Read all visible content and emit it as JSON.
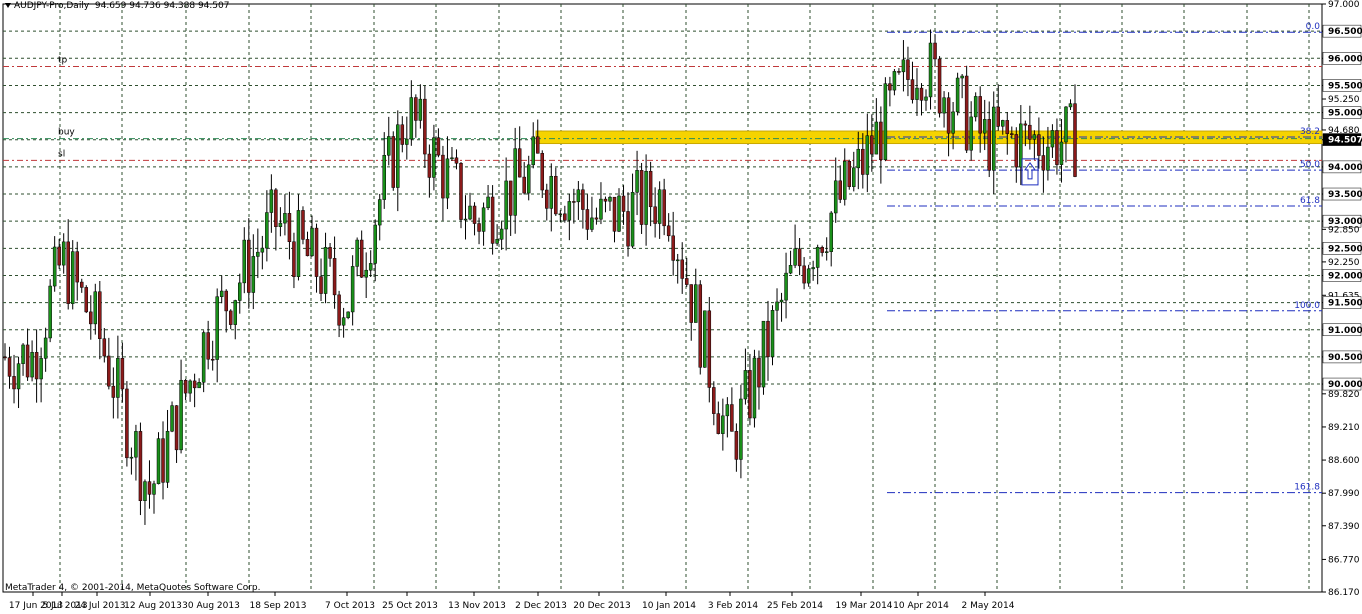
{
  "header": {
    "symbol": "AUDJPY-Pro,Daily",
    "ohlc": "94.659 94.736 94.388 94.507"
  },
  "footer": {
    "copyright": "MetaTrader 4, © 2001-2014, MetaQuotes Software Corp."
  },
  "colors": {
    "background": "#ffffff",
    "grid": "#2f4f2f",
    "bull_body": "#1a8f1a",
    "bear_body": "#8b1a1a",
    "wick": "#000000",
    "zone": "#f5d300",
    "tp_sl_line": "#c0393b",
    "buy_line": "#2e8b57",
    "fib_line": "#1f2fbf",
    "label_box": "#000000"
  },
  "chart_data": {
    "type": "candlestick",
    "title": "",
    "xlabel": "",
    "ylabel": "",
    "ylim": [
      86.17,
      97.0
    ],
    "grid": true,
    "price_axis_labels": [
      "97.000",
      "96.500",
      "96.000",
      "95.500",
      "95.250",
      "95.000",
      "94.680",
      "94.500",
      "94.000",
      "93.500",
      "93.000",
      "92.850",
      "92.500",
      "92.250",
      "92.000",
      "91.635",
      "91.500",
      "91.000",
      "90.500",
      "90.000",
      "89.820",
      "89.210",
      "88.600",
      "87.990",
      "87.390",
      "86.770",
      "86.170"
    ],
    "highlighted_price_labels": [
      "96.500",
      "96.000",
      "95.500",
      "95.000",
      "94.500",
      "94.000",
      "93.500",
      "93.000",
      "92.500",
      "92.000",
      "91.500",
      "91.000",
      "90.500",
      "90.000"
    ],
    "date_labels": [
      "17 Jun 2013",
      "5 Jul 2013",
      "24 Jul 2013",
      "12 Aug 2013",
      "30 Aug 2013",
      "18 Sep 2013",
      "7 Oct 2013",
      "25 Oct 2013",
      "13 Nov 2013",
      "2 Dec 2013",
      "20 Dec 2013",
      "10 Jan 2014",
      "3 Feb 2014",
      "25 Feb 2014",
      "19 Mar 2014",
      "10 Apr 2014",
      "2 May 2014"
    ],
    "current_price": 94.507,
    "horizontal_levels": [
      {
        "name": "tp",
        "price": 95.85
      },
      {
        "name": "buy",
        "price": 94.52
      },
      {
        "name": "sl",
        "price": 94.12
      }
    ],
    "support_zone": {
      "from_date": "13 Nov 2013",
      "price_low": 94.43,
      "price_high": 94.66
    },
    "fibonacci": {
      "from_date": "25 Feb 2014",
      "levels": [
        {
          "label": "0.0",
          "price": 96.48
        },
        {
          "label": "38.2",
          "price": 94.55
        },
        {
          "label": "50.0",
          "price": 93.94
        },
        {
          "label": "61.8",
          "price": 93.28
        },
        {
          "label": "100.0",
          "price": 91.35
        },
        {
          "label": "161.8",
          "price": 88.0
        }
      ]
    },
    "arrow_marker": {
      "date": "2 May 2014",
      "price": 94.0,
      "direction": "up"
    },
    "candles_summary": {
      "start": "17 Jun 2013",
      "end": "2 May 2014",
      "anchor_closes": [
        [
          "17 Jun 2013",
          90.5
        ],
        [
          "5 Jul 2013",
          92.3
        ],
        [
          "24 Jul 2013",
          91.0
        ],
        [
          "12 Aug 2013",
          88.0
        ],
        [
          "30 Aug 2013",
          91.0
        ],
        [
          "18 Sep 2013",
          93.0
        ],
        [
          "7 Oct 2013",
          91.5
        ],
        [
          "25 Oct 2013",
          95.0
        ],
        [
          "13 Nov 2013",
          93.0
        ],
        [
          "2 Dec 2013",
          94.0
        ],
        [
          "20 Dec 2013",
          93.0
        ],
        [
          "10 Jan 2014",
          93.5
        ],
        [
          "3 Feb 2014",
          88.8
        ],
        [
          "25 Feb 2014",
          92.0
        ],
        [
          "19 Mar 2014",
          94.0
        ],
        [
          "10 Apr 2014",
          96.0
        ],
        [
          "2 May 2014",
          94.5
        ]
      ]
    }
  }
}
